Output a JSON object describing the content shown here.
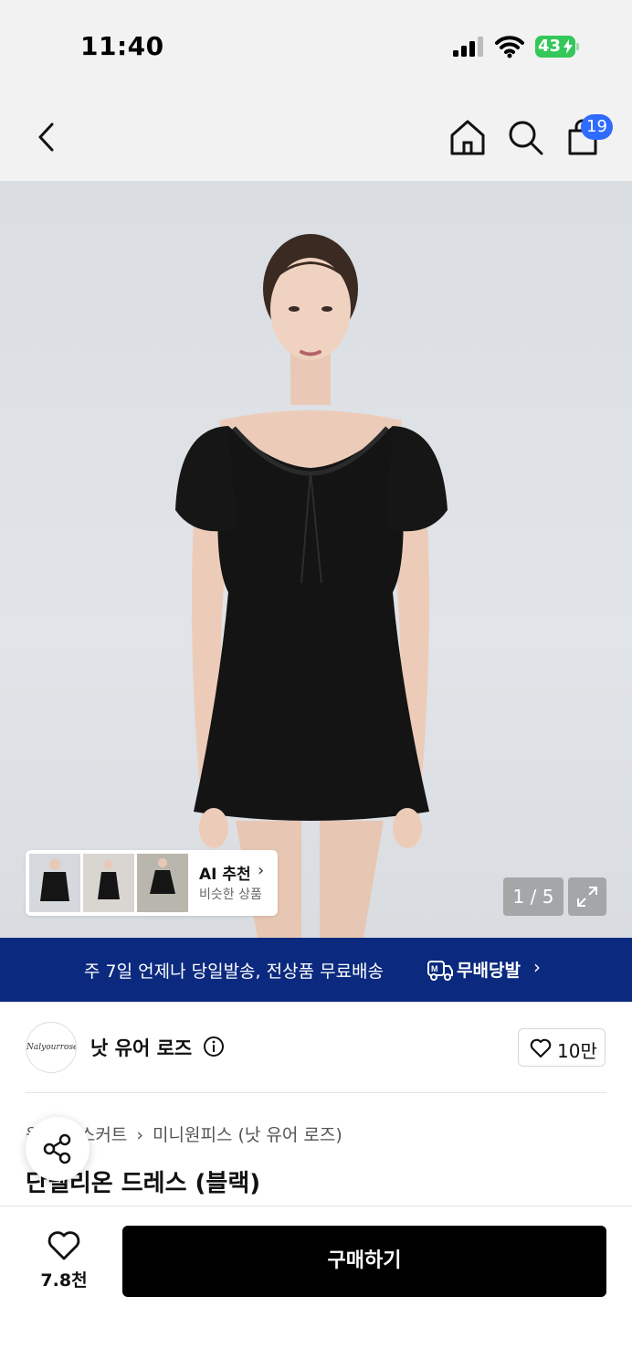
{
  "status_bar": {
    "time": "11:40",
    "battery": "43"
  },
  "nav": {
    "cart_count": "19",
    "icons": [
      "back-icon",
      "home-icon",
      "search-icon",
      "cart-icon"
    ]
  },
  "gallery": {
    "ai_title": "AI 추천",
    "ai_subtitle": "비슷한 상품",
    "page_counter": "1 / 5"
  },
  "banner": {
    "text": "주 7일 언제나 당일발송, 전상품 무료배송",
    "brand": "무배당발",
    "chevron": "›"
  },
  "brand": {
    "logo_text": "Nalyourrose",
    "name": "낫 유어 로즈",
    "like_count": "10만"
  },
  "product": {
    "breadcrumb": [
      "원피스/스커트",
      "›",
      "미니원피스 (낫 유어 로즈)"
    ],
    "title": "단델리온 드레스 (블랙)"
  },
  "bottom_bar": {
    "like_count": "7.8천",
    "buy_label": "구매하기"
  },
  "colors": {
    "banner_bg": "#0b2a7f",
    "badge": "#2f6bff",
    "buy_button": "#000000",
    "battery": "#34c759"
  }
}
